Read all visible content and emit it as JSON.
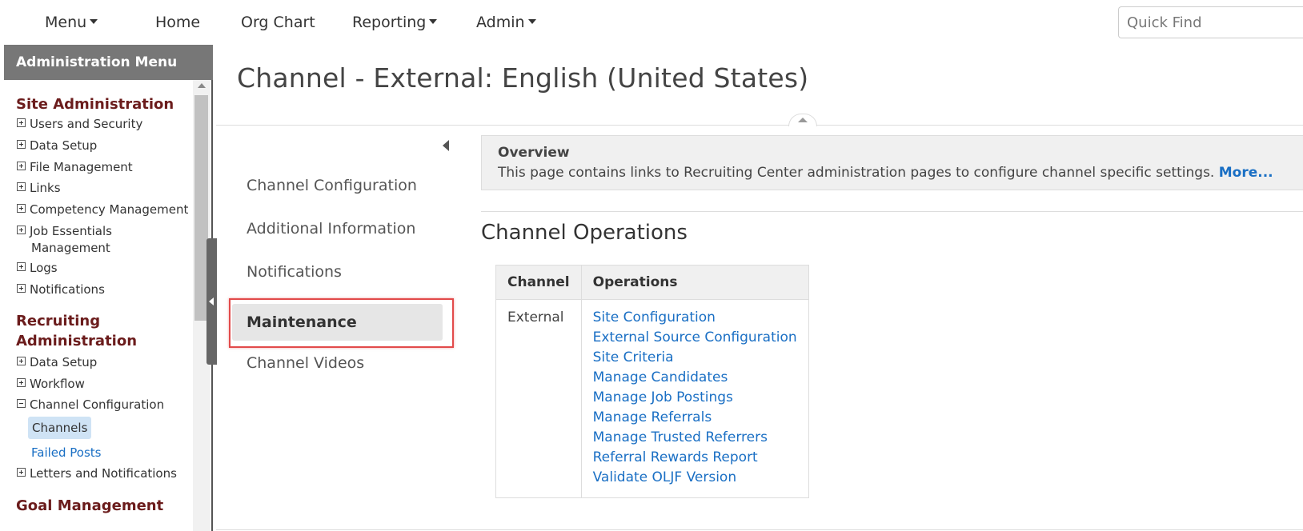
{
  "topnav": {
    "menu": "Menu",
    "home": "Home",
    "org_chart": "Org Chart",
    "reporting": "Reporting",
    "admin": "Admin",
    "quick_find_placeholder": "Quick Find"
  },
  "sidebar": {
    "header": "Administration Menu",
    "site_admin": {
      "title": "Site Administration",
      "items": [
        "Users and Security",
        "Data Setup",
        "File Management",
        "Links",
        "Competency Management",
        "Job Essentials",
        "Logs",
        "Notifications"
      ],
      "job_essentials_cont": "Management"
    },
    "recruiting_admin": {
      "title_line1": "Recruiting",
      "title_line2": "Administration",
      "items": [
        "Data Setup",
        "Workflow",
        "Channel Configuration"
      ],
      "sub_items": [
        "Channels",
        "Failed Posts"
      ],
      "letters": "Letters and Notifications"
    },
    "goal_management": "Goal Management"
  },
  "page": {
    "title": "Channel - External: English (United States)"
  },
  "subnav": {
    "items": [
      "Channel Configuration",
      "Additional Information",
      "Notifications",
      "Maintenance",
      "Channel Videos"
    ],
    "active": "Maintenance"
  },
  "overview": {
    "title": "Overview",
    "text": "This page contains links to Recruiting Center administration pages to configure channel specific settings.",
    "more": "More..."
  },
  "operations": {
    "heading": "Channel Operations",
    "columns": [
      "Channel",
      "Operations"
    ],
    "channel": "External",
    "links": [
      "Site Configuration",
      "External Source Configuration",
      "Site Criteria",
      "Manage Candidates",
      "Manage Job Postings",
      "Manage Referrals",
      "Manage Trusted Referrers",
      "Referral Rewards Report",
      "Validate OLJF Version"
    ]
  }
}
